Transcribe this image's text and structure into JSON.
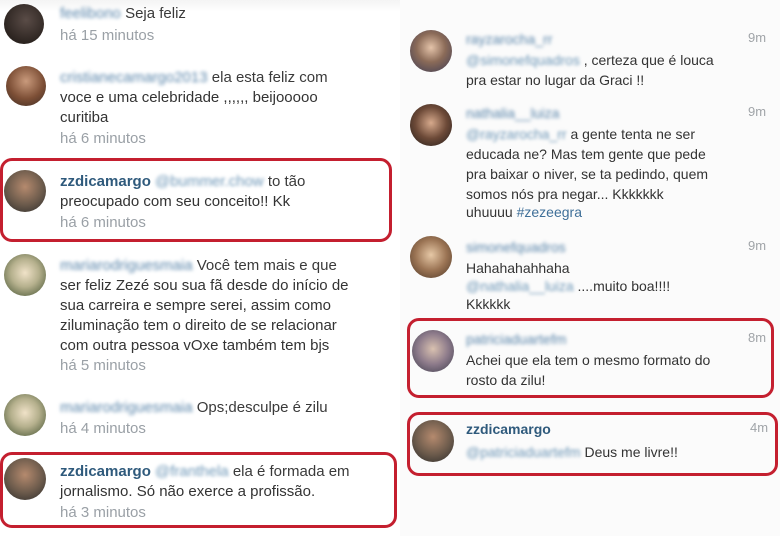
{
  "left": {
    "comments": [
      {
        "user": "feelibono",
        "text": "Seja feliz",
        "time": "há 15 minutos"
      },
      {
        "user": "cristianecamargo2013",
        "text_1": "ela esta feliz com",
        "text_2": "voce e uma celebridade ,,,,,, beijooooo",
        "text_3": "curitiba",
        "time": "há 6 minutos"
      },
      {
        "user": "zzdicamargo",
        "mention": "@bummer.chow",
        "text_1": "to tão",
        "text_2": "preocupado com seu conceito!! Kk",
        "time": "há 6 minutos"
      },
      {
        "user": "mariarodriguesmaia",
        "text_1": "Você tem mais e que",
        "text_2": "ser feliz Zezé sou sua fã desde do início de",
        "text_3": "sua carreira e sempre serei, assim como",
        "text_4": "ziluminação tem o direito de se relacionar",
        "text_5": "com outra pessoa vOxe também tem bjs",
        "time": "há 5 minutos"
      },
      {
        "user": "mariarodriguesmaia",
        "text": "Ops;desculpe é zilu",
        "time": "há 4 minutos"
      },
      {
        "user": "zzdicamargo",
        "mention": "@franthela",
        "text_1": "ela é formada em",
        "text_2": "jornalismo. Só não exerce a profissão.",
        "time": "há 3 minutos"
      }
    ]
  },
  "right": {
    "comments": [
      {
        "user": "rayzarocha_rr",
        "mention": "@simonefquadros",
        "text_1": ", certeza que é louca",
        "text_2": "pra estar no lugar da Graci !!",
        "time": ""
      },
      {
        "user": "nathalia__luiza",
        "mention": "@rayzarocha_rr",
        "text_1": "a gente tenta ne ser",
        "text_2": "educada ne? Mas tem gente que pede",
        "text_3": "pra baixar o niver, se ta pedindo, quem",
        "text_4": "somos nós pra negar... Kkkkkkk",
        "text_5": "uhuuuu",
        "hashtag": "#zezeegra",
        "time": "9m"
      },
      {
        "user": "simonefquadros",
        "text_1": "Hahahahahhaha",
        "mention": "@nathalia__luiza",
        "text_2": "....muito boa!!!!",
        "text_3": "Kkkkkk",
        "time": "9m"
      },
      {
        "user": "patriciaduartefm",
        "text_1": "Achei que ela tem o mesmo formato do",
        "text_2": "rosto da zilu!",
        "time": "8m"
      },
      {
        "user": "zzdicamargo",
        "mention": "@patriciaduartefm",
        "text": "Deus me livre!!",
        "time": "4m"
      }
    ],
    "time_first": "9m"
  },
  "colors": {
    "highlight": "#c41f2f",
    "username": "#2f5a7c",
    "mention": "#6f98b8",
    "timestamp": "#9aa0a6"
  }
}
